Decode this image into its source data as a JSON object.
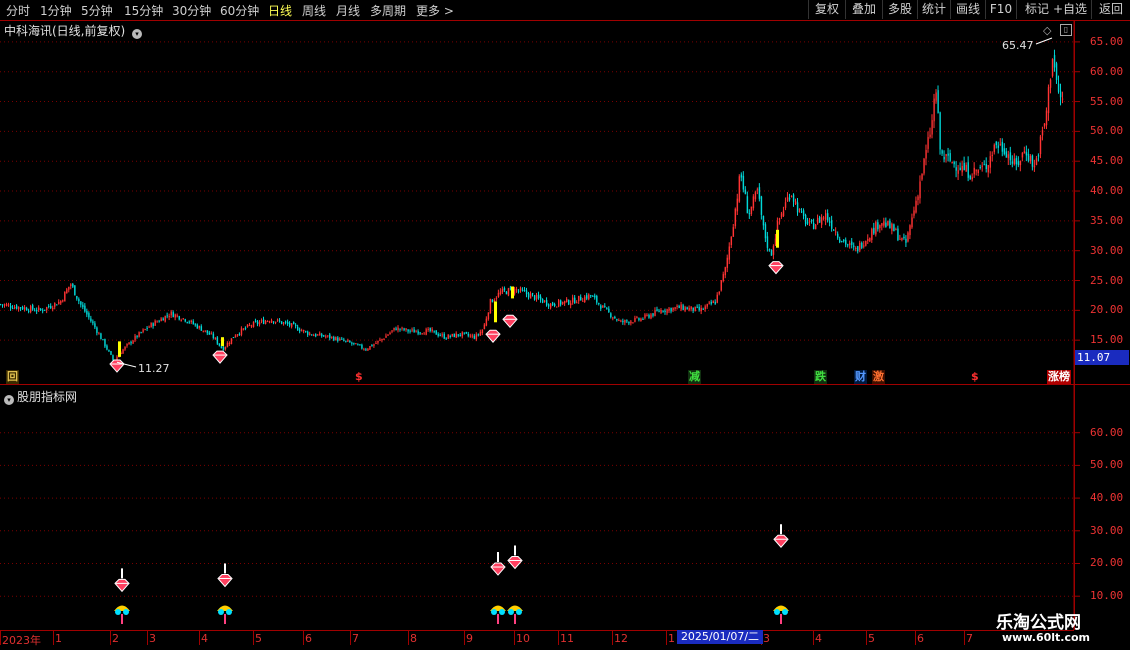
{
  "toolbar": {
    "periods": [
      "分时",
      "1分钟",
      "5分钟",
      "15分钟",
      "30分钟",
      "60分钟",
      "日线",
      "周线",
      "月线",
      "多周期",
      "更多 >"
    ],
    "active_period": "日线",
    "right_buttons": [
      "复权",
      "叠加",
      "多股",
      "统计",
      "画线",
      "F10",
      "+自选",
      "返回"
    ]
  },
  "main_panel": {
    "title": "中科海讯(日线,前复权)",
    "high_label": "65.47",
    "low_label": "11.27",
    "last_price": "11.07",
    "y_ticks": [
      "65.00",
      "60.00",
      "55.00",
      "50.00",
      "45.00",
      "40.00",
      "35.00",
      "30.00",
      "25.00",
      "20.00",
      "15.00"
    ],
    "ylim": [
      10.0,
      68.0
    ]
  },
  "event_markers": [
    {
      "label": "回",
      "color": "#e0c050",
      "bg": "#3a2a00"
    },
    {
      "label": "$",
      "color": "#ff3030",
      "bg": "transparent"
    },
    {
      "label": "减",
      "color": "#40e040",
      "bg": "#103010"
    },
    {
      "label": "跌",
      "color": "#40e040",
      "bg": "#103010"
    },
    {
      "label": "财",
      "color": "#5599ff",
      "bg": "#001a40"
    },
    {
      "label": "激",
      "color": "#ff7030",
      "bg": "#401000"
    },
    {
      "label": "$",
      "color": "#ff3030",
      "bg": "transparent"
    },
    {
      "label": "涨榜",
      "color": "#ffffff",
      "bg": "#b00000"
    }
  ],
  "indicator_panel": {
    "title": "股朋指标网",
    "y_ticks": [
      "60.00",
      "50.00",
      "40.00",
      "30.00",
      "20.00",
      "10.00"
    ],
    "ylim": [
      7.0,
      70.0
    ],
    "signals": [
      {
        "day": 0.112,
        "value": 13.0
      },
      {
        "day": 0.215,
        "value": 14.5
      },
      {
        "day": 0.488,
        "value": 18.0
      },
      {
        "day": 0.505,
        "value": 20.0
      },
      {
        "day": 0.771,
        "value": 26.5
      }
    ]
  },
  "time_axis": {
    "labels": [
      "2023年",
      "1",
      "2",
      "3",
      "4",
      "5",
      "6",
      "7",
      "8",
      "9",
      "10",
      "11",
      "12",
      "1",
      "3",
      "4",
      "5",
      "6",
      "7"
    ],
    "cursor_date": "2025/01/07/二"
  },
  "watermark": {
    "title": "乐淘公式网",
    "url": "www.60lt.com"
  },
  "colors": {
    "up": "#ff3333",
    "down": "#00d8d8",
    "grid": "#7a0000",
    "axis": "#ee3333",
    "active": "#ffff55"
  },
  "chart_data": {
    "type": "candlestick",
    "title": "中科海讯(日线,前复权)",
    "ylim": [
      10.0,
      68.0
    ],
    "close_path": [
      [
        0.0,
        21.0
      ],
      [
        0.02,
        20.5
      ],
      [
        0.04,
        20.0
      ],
      [
        0.06,
        21.5
      ],
      [
        0.07,
        24.5
      ],
      [
        0.08,
        21.0
      ],
      [
        0.095,
        17.0
      ],
      [
        0.105,
        14.0
      ],
      [
        0.113,
        11.5
      ],
      [
        0.12,
        13.0
      ],
      [
        0.135,
        15.5
      ],
      [
        0.15,
        17.5
      ],
      [
        0.17,
        19.5
      ],
      [
        0.185,
        18.5
      ],
      [
        0.2,
        17.0
      ],
      [
        0.213,
        15.5
      ],
      [
        0.222,
        13.5
      ],
      [
        0.235,
        16.0
      ],
      [
        0.25,
        17.5
      ],
      [
        0.27,
        18.5
      ],
      [
        0.29,
        17.5
      ],
      [
        0.31,
        16.0
      ],
      [
        0.33,
        15.5
      ],
      [
        0.35,
        14.5
      ],
      [
        0.365,
        13.5
      ],
      [
        0.38,
        15.0
      ],
      [
        0.395,
        17.0
      ],
      [
        0.41,
        16.5
      ],
      [
        0.43,
        16.5
      ],
      [
        0.445,
        15.5
      ],
      [
        0.46,
        16.0
      ],
      [
        0.475,
        15.5
      ],
      [
        0.483,
        17.0
      ],
      [
        0.49,
        21.5
      ],
      [
        0.5,
        23.0
      ],
      [
        0.515,
        23.5
      ],
      [
        0.53,
        22.5
      ],
      [
        0.55,
        21.0
      ],
      [
        0.57,
        21.5
      ],
      [
        0.59,
        22.5
      ],
      [
        0.605,
        20.0
      ],
      [
        0.62,
        18.0
      ],
      [
        0.64,
        18.5
      ],
      [
        0.66,
        20.0
      ],
      [
        0.68,
        20.5
      ],
      [
        0.7,
        20.0
      ],
      [
        0.715,
        21.5
      ],
      [
        0.725,
        27.0
      ],
      [
        0.733,
        35.0
      ],
      [
        0.74,
        43.0
      ],
      [
        0.748,
        36.0
      ],
      [
        0.757,
        40.0
      ],
      [
        0.763,
        33.5
      ],
      [
        0.77,
        29.0
      ],
      [
        0.778,
        35.0
      ],
      [
        0.79,
        40.0
      ],
      [
        0.8,
        36.0
      ],
      [
        0.81,
        34.0
      ],
      [
        0.825,
        36.0
      ],
      [
        0.84,
        32.0
      ],
      [
        0.855,
        30.0
      ],
      [
        0.87,
        33.0
      ],
      [
        0.88,
        35.0
      ],
      [
        0.893,
        33.5
      ],
      [
        0.905,
        31.0
      ],
      [
        0.915,
        38.0
      ],
      [
        0.925,
        46.0
      ],
      [
        0.932,
        52.0
      ],
      [
        0.935,
        58.0
      ],
      [
        0.94,
        46.0
      ],
      [
        0.955,
        44.5
      ],
      [
        0.97,
        43.0
      ],
      [
        0.985,
        44.0
      ],
      [
        0.995,
        48.0
      ],
      [
        1.005,
        47.0
      ],
      [
        1.015,
        44.0
      ],
      [
        1.025,
        47.0
      ],
      [
        1.034,
        44.0
      ],
      [
        1.045,
        52.0
      ],
      [
        1.052,
        63.0
      ],
      [
        1.058,
        56.0
      ],
      [
        1.064,
        55.0
      ]
    ],
    "buy_signals": [
      {
        "day": 0.112,
        "price": 10.5
      },
      {
        "day": 0.215,
        "price": 12.0
      },
      {
        "day": 0.488,
        "price": 15.5
      },
      {
        "day": 0.505,
        "price": 18.0
      },
      {
        "day": 0.771,
        "price": 27.0
      }
    ],
    "yellow_bars": [
      {
        "day": 0.114,
        "low": 12.2,
        "high": 14.8
      },
      {
        "day": 0.217,
        "low": 14.0,
        "high": 15.5
      },
      {
        "day": 0.49,
        "low": 18.0,
        "high": 21.5
      },
      {
        "day": 0.507,
        "low": 22.0,
        "high": 24.0
      },
      {
        "day": 0.772,
        "low": 30.5,
        "high": 33.5
      }
    ]
  }
}
